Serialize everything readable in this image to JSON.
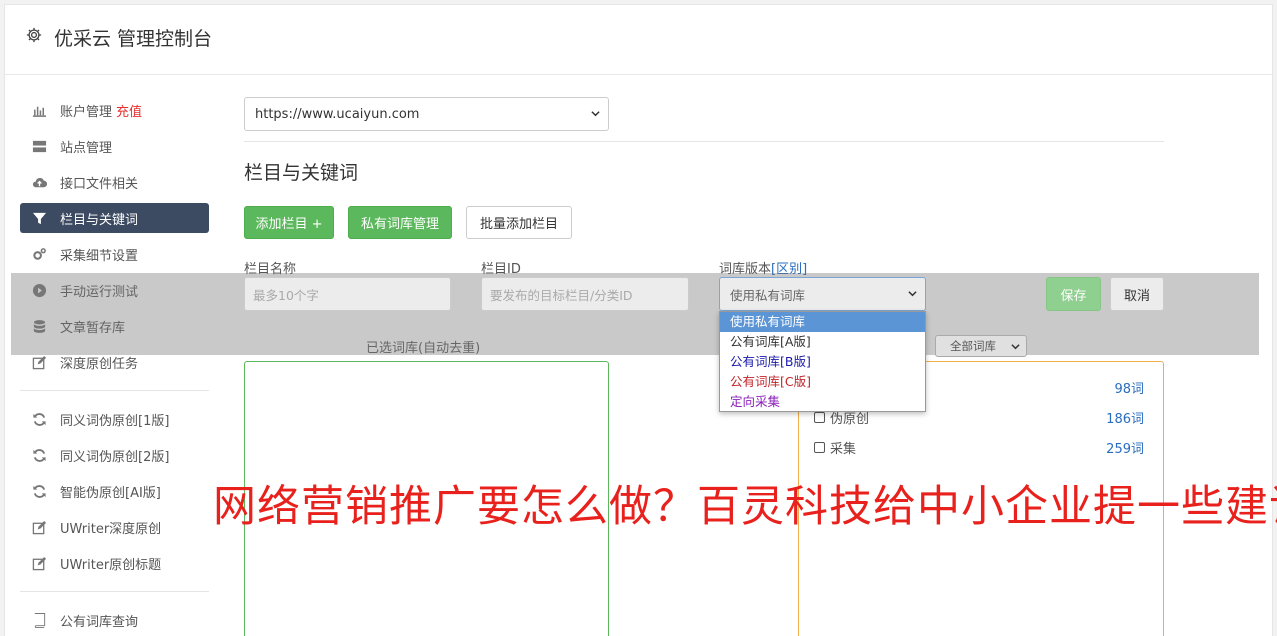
{
  "header": {
    "title": "优采云 管理控制台",
    "icon": "gear-icon"
  },
  "sidebar": {
    "items": [
      {
        "label": "账户管理",
        "badge": "充值",
        "icon": "bar-chart-icon"
      },
      {
        "label": "站点管理",
        "icon": "server-icon"
      },
      {
        "label": "接口文件相关",
        "icon": "cloud-upload-icon"
      },
      {
        "label": "栏目与关键词",
        "icon": "filter-icon",
        "active": true
      },
      {
        "label": "采集细节设置",
        "icon": "gears-icon"
      },
      {
        "label": "手动运行测试",
        "icon": "play-circle-icon"
      },
      {
        "label": "文章暂存库",
        "icon": "database-icon"
      },
      {
        "label": "深度原创任务",
        "icon": "edit-icon"
      },
      {
        "label": "同义词伪原创[1版]",
        "icon": "refresh-icon"
      },
      {
        "label": "同义词伪原创[2版]",
        "icon": "refresh-icon"
      },
      {
        "label": "智能伪原创[AI版]",
        "icon": "refresh-icon"
      },
      {
        "label": "UWriter深度原创",
        "icon": "edit-icon"
      },
      {
        "label": "UWriter原创标题",
        "icon": "edit-icon"
      },
      {
        "label": "公有词库查询",
        "icon": "book-icon"
      }
    ]
  },
  "main": {
    "site_select": "https://www.ucaiyun.com",
    "section_title": "栏目与关键词",
    "buttons": {
      "add_column": "添加栏目 +",
      "private_lib": "私有词库管理",
      "batch_add": "批量添加栏目",
      "save": "保存",
      "cancel": "取消"
    },
    "form": {
      "column_name_label": "栏目名称",
      "column_name_placeholder": "最多10个字",
      "column_id_label": "栏目ID",
      "column_id_placeholder": "要发布的目标栏目/分类ID",
      "version_label": "词库版本",
      "version_link": "[区别]",
      "version_value": "使用私有词库"
    },
    "version_options": [
      {
        "label": "使用私有词库",
        "color": "#ffffff"
      },
      {
        "label": "公有词库[A版]",
        "color": "#333333"
      },
      {
        "label": "公有词库[B版]",
        "color": "#1a1aa8"
      },
      {
        "label": "公有词库[C版]",
        "color": "#c0262b"
      },
      {
        "label": "定向采集",
        "color": "#8a1fb8"
      }
    ],
    "selected_lib_title": "已选词库(自动去重)",
    "all_lib_select": "全部词库",
    "libraries": [
      {
        "name": "",
        "count": "98词"
      },
      {
        "name": "伪原创",
        "count": "186词"
      },
      {
        "name": "采集",
        "count": "259词"
      }
    ]
  },
  "watermark": "网络营销推广要怎么做？百灵科技给中小企业提一些建议"
}
